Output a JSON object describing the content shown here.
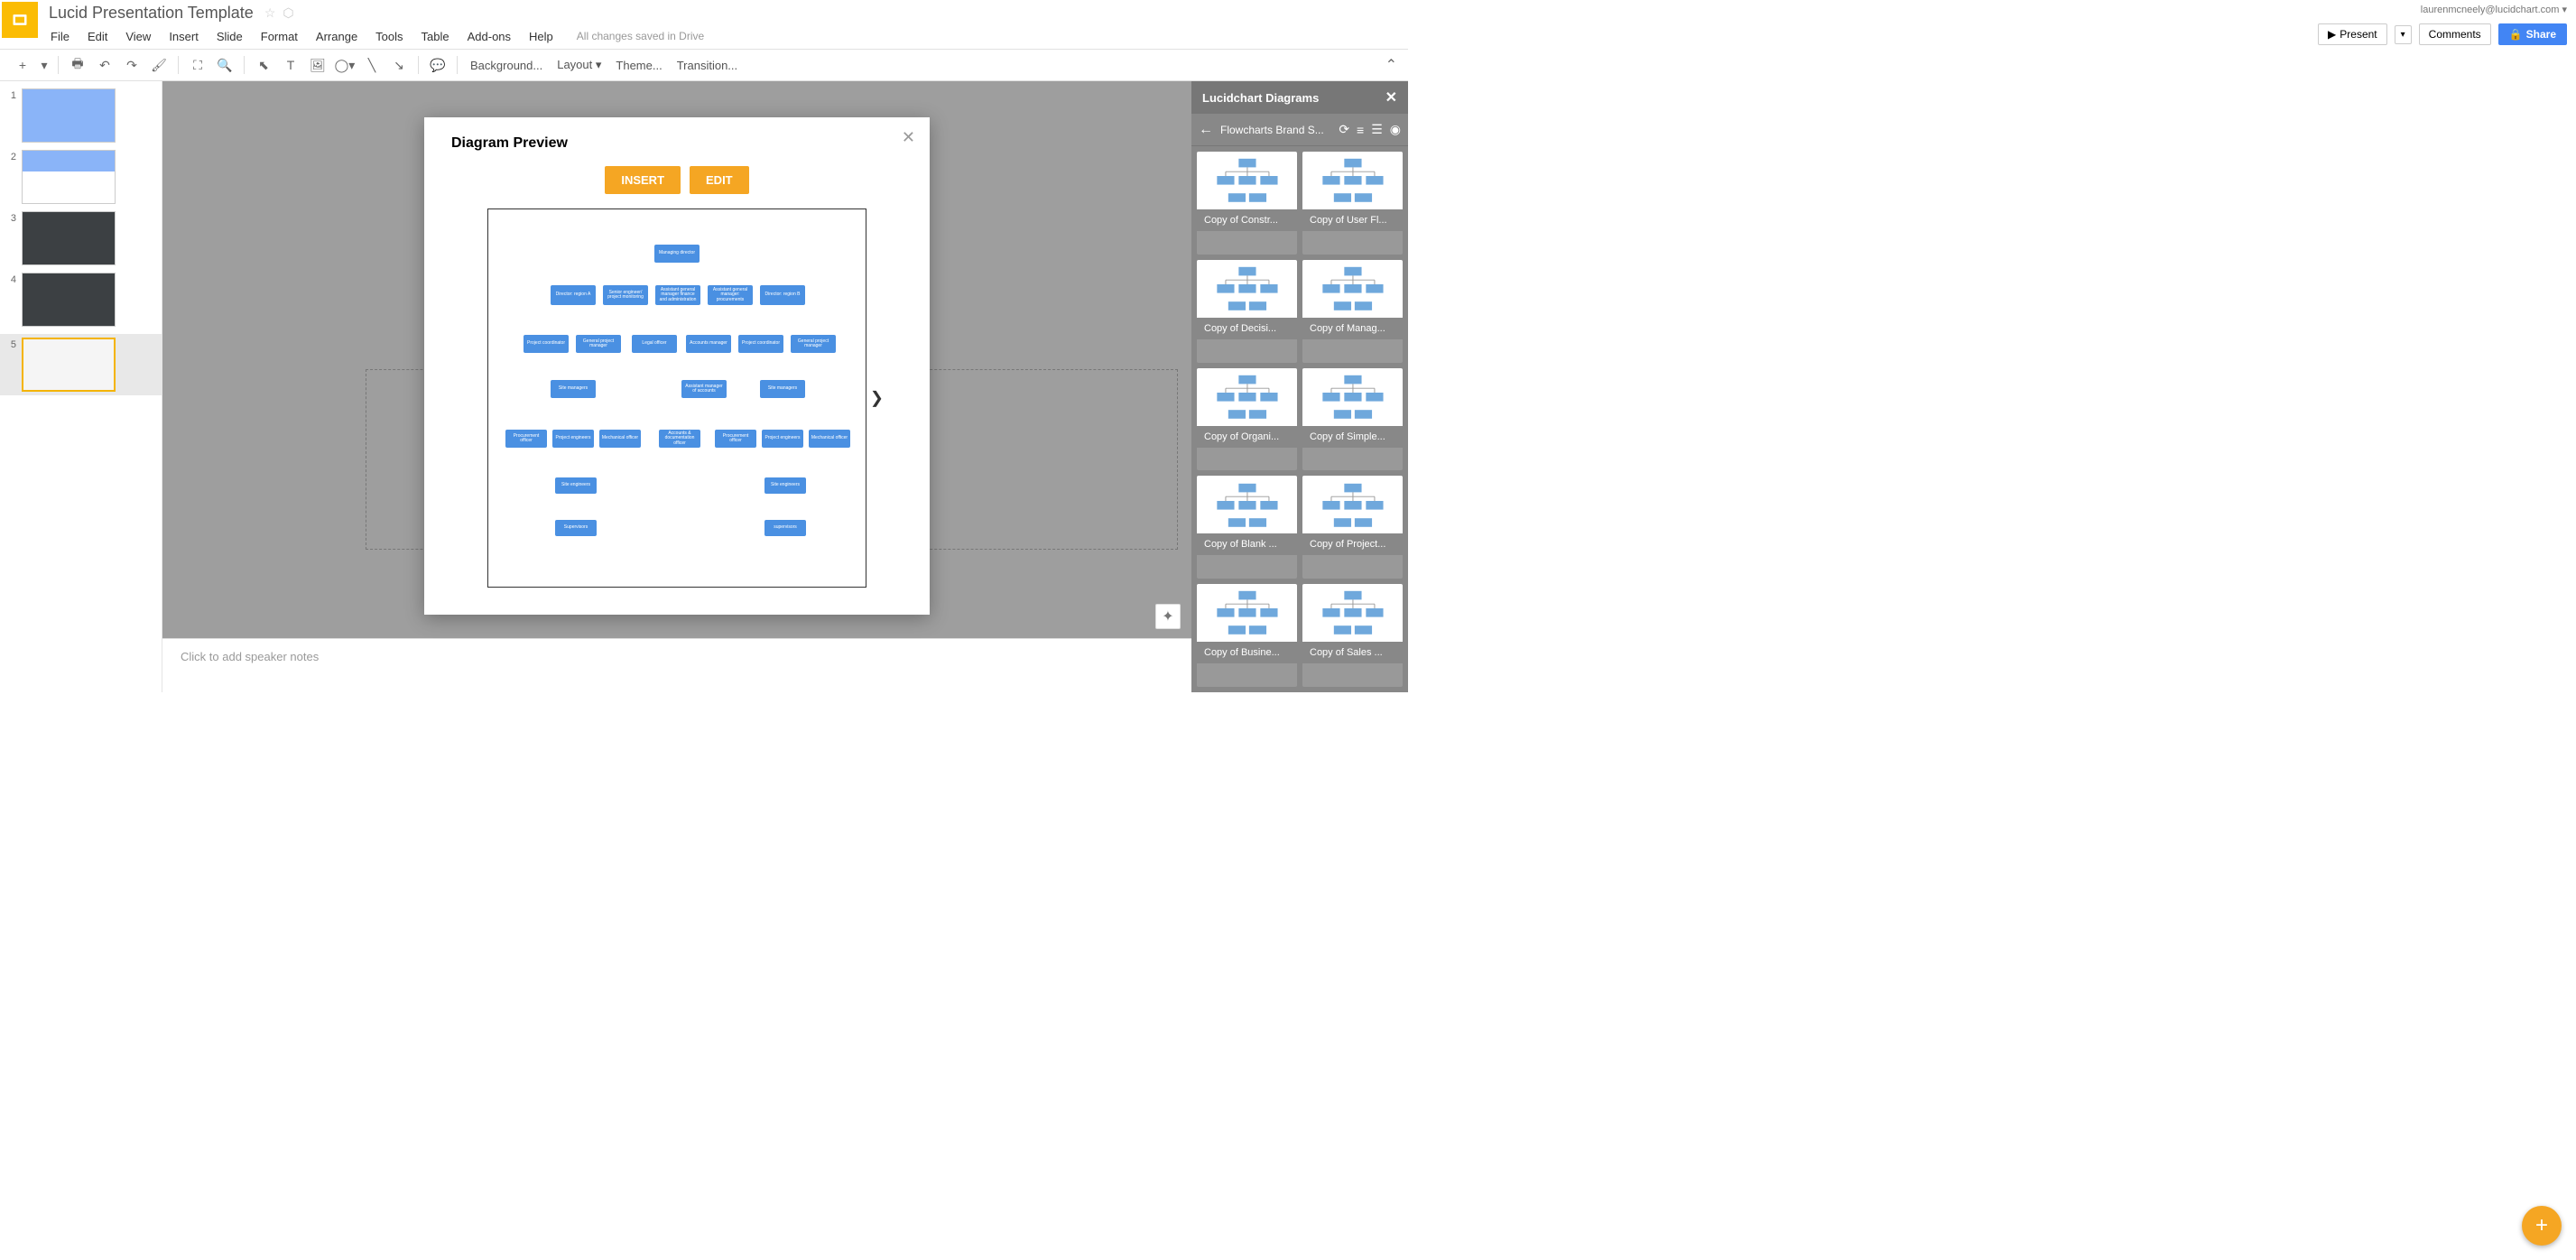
{
  "header": {
    "doc_title": "Lucid Presentation Template",
    "user_email": "laurenmcneely@lucidchart.com"
  },
  "menubar": {
    "items": [
      "File",
      "Edit",
      "View",
      "Insert",
      "Slide",
      "Format",
      "Arrange",
      "Tools",
      "Table",
      "Add-ons",
      "Help"
    ],
    "save_status": "All changes saved in Drive"
  },
  "top_buttons": {
    "present": "Present",
    "comments": "Comments",
    "share": "Share"
  },
  "toolbar": {
    "background": "Background...",
    "layout": "Layout",
    "theme": "Theme...",
    "transition": "Transition..."
  },
  "slides": [
    {
      "num": "1"
    },
    {
      "num": "2"
    },
    {
      "num": "3"
    },
    {
      "num": "4"
    },
    {
      "num": "5"
    }
  ],
  "notes_placeholder": "Click to add speaker notes",
  "sidebar": {
    "header": "Lucidchart Diagrams",
    "folder": "Flowcharts Brand S...",
    "diagrams": [
      "Copy of Constr...",
      "Copy of User Fl...",
      "Copy of Decisi...",
      "Copy of Manag...",
      "Copy of Organi...",
      "Copy of Simple...",
      "Copy of Blank ...",
      "Copy of Project...",
      "Copy of Busine...",
      "Copy of Sales ..."
    ]
  },
  "modal": {
    "title": "Diagram Preview",
    "insert": "INSERT",
    "edit": "EDIT"
  },
  "org_chart": {
    "root": "Managing director",
    "level2": [
      "Director: region A",
      "Senior engineer/ project monitoring",
      "Assistant general manager finance and administration",
      "Assistant general manager: procurements",
      "Director: region B"
    ],
    "level3": [
      "Project coordinator",
      "General project manager",
      "Legal officer",
      "Accounts manager",
      "Project coordinator",
      "General project manager"
    ],
    "level4": [
      "Site managers",
      "Assistant manager of accounts",
      "Site managers"
    ],
    "level5": [
      "Procurement officer",
      "Project engineers",
      "Mechanical officer",
      "Accounts & documentation officer",
      "Procurement officer",
      "Project engineers",
      "Mechanical officer"
    ],
    "level6": [
      "Site engineers",
      "Site engineers"
    ],
    "level7": [
      "Supervisors",
      "supervisors"
    ]
  }
}
